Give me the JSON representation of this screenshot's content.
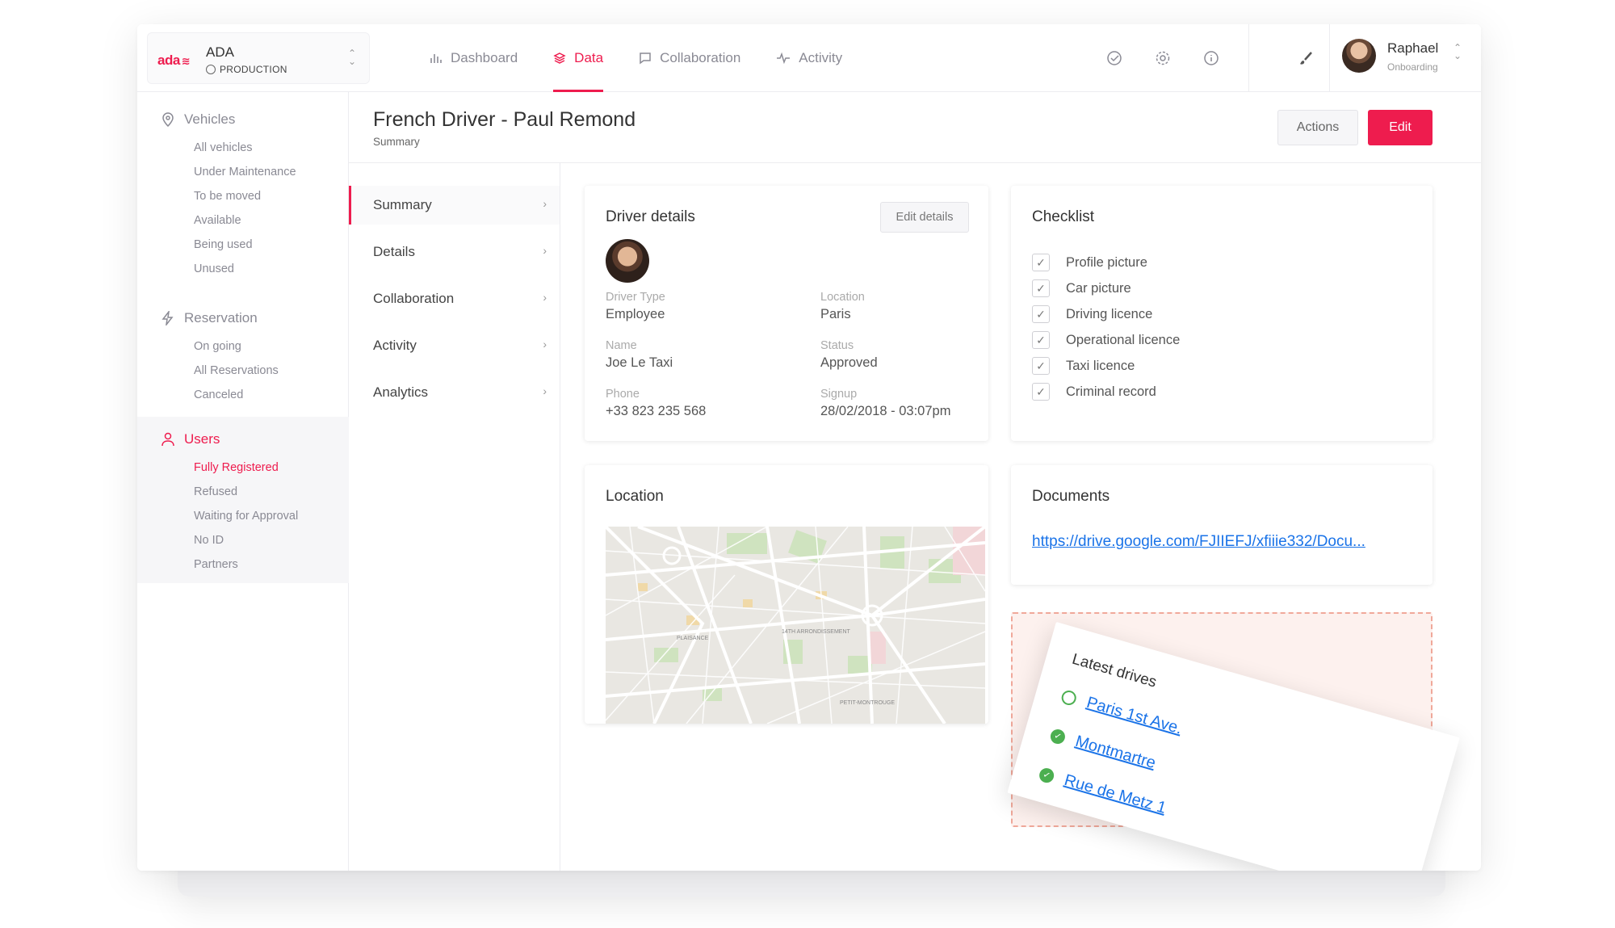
{
  "app": {
    "env_name": "ADA",
    "env_label": "PRODUCTION",
    "logo_text": "ada",
    "brand_color": "#ee1c4e"
  },
  "nav": {
    "items": [
      {
        "label": "Dashboard",
        "icon": "bar-chart-icon"
      },
      {
        "label": "Data",
        "icon": "layers-icon",
        "active": true
      },
      {
        "label": "Collaboration",
        "icon": "chat-icon"
      },
      {
        "label": "Activity",
        "icon": "activity-icon"
      }
    ]
  },
  "user": {
    "name": "Raphael",
    "role": "Onboarding"
  },
  "sidebar": {
    "vehicles": {
      "label": "Vehicles",
      "items": [
        "All vehicles",
        "Under Maintenance",
        "To be moved",
        "Available",
        "Being used",
        "Unused"
      ]
    },
    "reservation": {
      "label": "Reservation",
      "items": [
        "On going",
        "All Reservations",
        "Canceled"
      ]
    },
    "users": {
      "label": "Users",
      "items": [
        "Fully Registered",
        "Refused",
        "Waiting for Approval",
        "No ID",
        "Partners"
      ],
      "active_item": "Fully Registered"
    }
  },
  "page": {
    "title": "French Driver - Paul Remond",
    "subtitle": "Summary",
    "actions_label": "Actions",
    "edit_label": "Edit"
  },
  "subnav": {
    "items": [
      "Summary",
      "Details",
      "Collaboration",
      "Activity",
      "Analytics"
    ],
    "active": "Summary"
  },
  "driver_details": {
    "title": "Driver details",
    "edit_details_label": "Edit details",
    "fields": {
      "driver_type": {
        "label": "Driver Type",
        "value": "Employee"
      },
      "location": {
        "label": "Location",
        "value": "Paris"
      },
      "name": {
        "label": "Name",
        "value": "Joe Le Taxi"
      },
      "status": {
        "label": "Status",
        "value": "Approved"
      },
      "phone": {
        "label": "Phone",
        "value": "+33 823 235 568"
      },
      "signup": {
        "label": "Signup",
        "value": "28/02/2018 - 03:07pm"
      }
    }
  },
  "checklist": {
    "title": "Checklist",
    "items": [
      "Profile picture",
      "Car picture",
      "Driving licence",
      "Operational licence",
      "Taxi licence",
      "Criminal record"
    ]
  },
  "location": {
    "title": "Location",
    "map_labels": [
      "PLAISANCE",
      "14TH ARRONDISSEMENT",
      "PETIT-MONTROUGE"
    ]
  },
  "documents": {
    "title": "Documents",
    "link": "https://drive.google.com/FJIIEFJ/xfiiie332/Docu..."
  },
  "latest_drives": {
    "title": "Latest drives",
    "items": [
      {
        "label": "Paris 1st Ave.",
        "done": false
      },
      {
        "label": "Montmartre",
        "done": true
      },
      {
        "label": "Rue de Metz 1",
        "done": true
      }
    ]
  }
}
